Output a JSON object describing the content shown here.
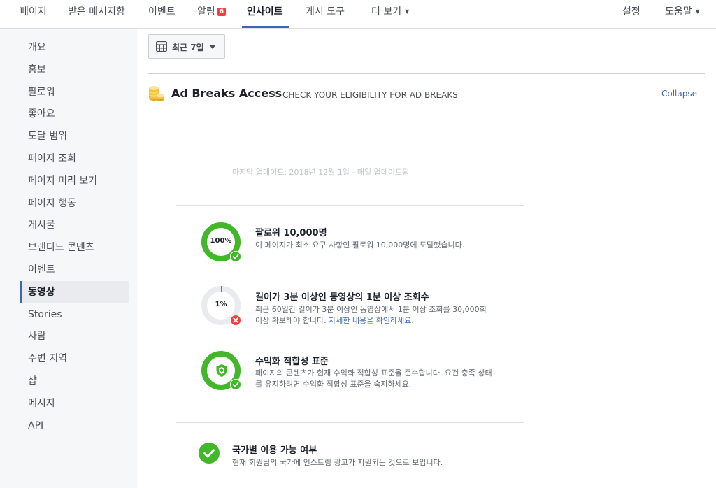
{
  "nav": {
    "items": [
      {
        "label": "페이지"
      },
      {
        "label": "받은 메시지함"
      },
      {
        "label": "이벤트"
      },
      {
        "label": "알림",
        "badge": "6"
      },
      {
        "label": "인사이트"
      },
      {
        "label": "게시 도구"
      },
      {
        "label": "더 보기"
      }
    ],
    "settings": "설정",
    "help": "도움말"
  },
  "sidebar": {
    "items": [
      {
        "label": "개요"
      },
      {
        "label": "홍보"
      },
      {
        "label": "팔로워"
      },
      {
        "label": "좋아요"
      },
      {
        "label": "도달 범위"
      },
      {
        "label": "페이지 조회"
      },
      {
        "label": "페이지 미리 보기"
      },
      {
        "label": "페이지 행동"
      },
      {
        "label": "게시물"
      },
      {
        "label": "브랜디드 콘텐츠"
      },
      {
        "label": "이벤트"
      },
      {
        "label": "동영상"
      },
      {
        "label": "Stories"
      },
      {
        "label": "사람"
      },
      {
        "label": "주변 지역"
      },
      {
        "label": "샵"
      },
      {
        "label": "메시지"
      },
      {
        "label": "API"
      }
    ],
    "active_index": 11
  },
  "date_range": {
    "label": "최근 7일"
  },
  "section": {
    "title": "Ad Breaks Access",
    "separator": "›",
    "subtitle": "CHECK YOUR ELIGIBILITY FOR AD BREAKS",
    "collapse": "Collapse"
  },
  "last_update": "마지막 업데이트: 2018년 12월 1일 - 매일 업데이트됨",
  "criteria": [
    {
      "progress_label": "100%",
      "progress": 1.0,
      "met": true,
      "title": "팔로워 10,000명",
      "description": "이 페이지가 최소 요구 사항인 팔로워 10,000명에 도달했습니다."
    },
    {
      "progress_label": "1%",
      "progress": 0.01,
      "met": false,
      "title": "길이가 3분 이상인 동영상의 1분 이상 조회수",
      "description": "최근 60일간 길이가 3분 이상인 동영상에서 1분 이상 조회를 30,000회 이상 확보해야 합니다.",
      "link": "자세한 내용을 확인하세요."
    },
    {
      "icon": "shield-icon",
      "met": true,
      "title": "수익화 적합성 표준",
      "description": "페이지의 콘텐츠가 현재 수익화 적합성 표준을 준수합니다. 요건 충족 상태를 유지하려면 수익화 적합성 표준을 숙지하세요."
    }
  ],
  "country": {
    "met": true,
    "title": "국가별 이용 가능 여부",
    "description": "현재 회원님의 국가에 인스트림 광고가 지원되는 것으로 보입니다."
  },
  "colors": {
    "brand_blue": "#4267b2",
    "success_green": "#42b72a",
    "error_red": "#fa3e3e",
    "ring_track": "#e9ebee",
    "coin_yellow": "#f5c33b"
  }
}
